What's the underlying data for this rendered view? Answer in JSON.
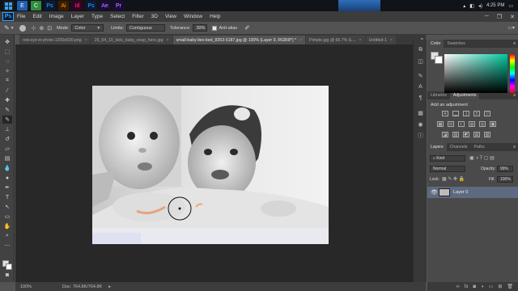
{
  "taskbar": {
    "start_icon": "windows-start-icon",
    "apps": [
      "E",
      "C",
      "Ps",
      "Ai",
      "Id",
      "Ps",
      "Ae",
      "Pr"
    ],
    "time": "4:25 PM"
  },
  "app": {
    "logo": "Ps"
  },
  "menu": [
    "File",
    "Edit",
    "Image",
    "Layer",
    "Type",
    "Select",
    "Filter",
    "3D",
    "View",
    "Window",
    "Help"
  ],
  "options": {
    "mode_label": "Mode:",
    "mode_value": "Color",
    "limits_label": "Limits:",
    "limits_value": "Contiguous",
    "tolerance_label": "Tolerance:",
    "tolerance_value": "30%",
    "antialias_label": "Anti-alias"
  },
  "tabs": [
    {
      "label": "red-eye-in-photo-1200x630.png",
      "active": false
    },
    {
      "label": "25_04_10_kids_baby_essp_hero.jpg",
      "active": false
    },
    {
      "label": "small-baby-lies-bed_8353-5187.jpg @ 100% (Layer 0, RGB/8*) *",
      "active": true
    },
    {
      "label": "Pimple.jpg @ 66.7% (L...",
      "active": false
    },
    {
      "label": "Untitled-1",
      "active": false
    }
  ],
  "status": {
    "zoom": "100%",
    "doc": "Doc: 764.8K/764.8K"
  },
  "panels": {
    "color_tab": "Color",
    "swatches_tab": "Swatches",
    "libraries_tab": "Libraries",
    "adjustments_tab": "Adjustments",
    "add_adjustment": "Add an adjustment",
    "layers_tab": "Layers",
    "channels_tab": "Channels",
    "paths_tab": "Paths",
    "kind_label": "Kind",
    "blend_mode": "Normal",
    "opacity_label": "Opacity:",
    "opacity_value": "99%",
    "lock_label": "Lock:",
    "fill_label": "Fill:",
    "fill_value": "100%",
    "layer_name": "Layer 0"
  },
  "colors": {
    "accent": "#31a8ff",
    "panel": "#4a4a4a",
    "selected_layer": "#5d6a80"
  }
}
